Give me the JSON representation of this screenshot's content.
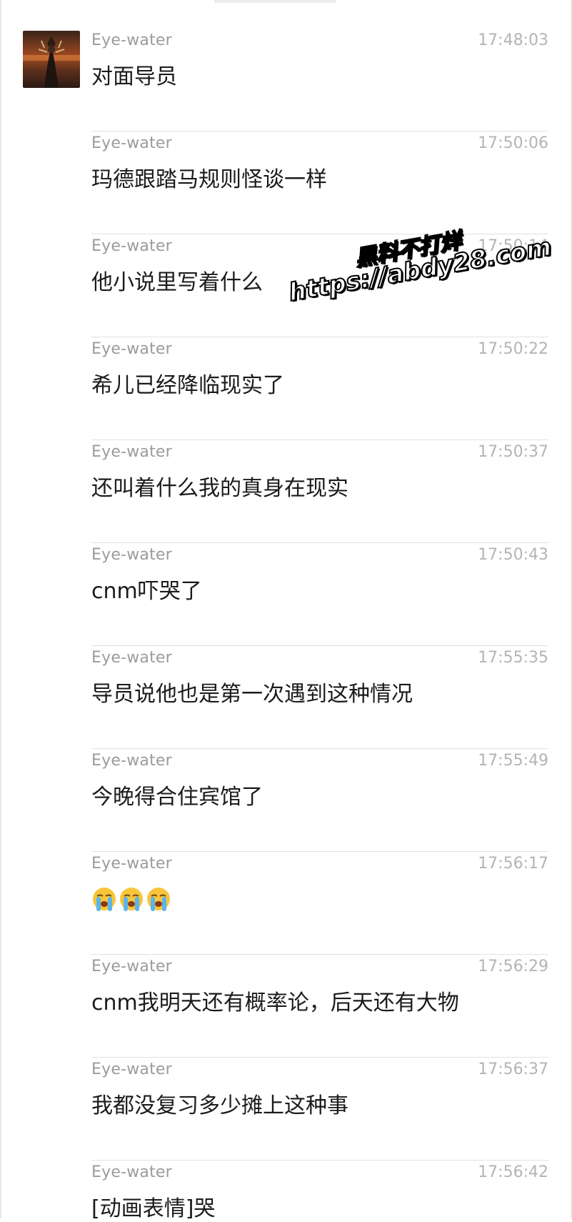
{
  "messages": [
    {
      "sender": "Eye-water",
      "time": "17:48:03",
      "text": "对面导员"
    },
    {
      "sender": "Eye-water",
      "time": "17:50:06",
      "text": "玛德跟踏马规则怪谈一样"
    },
    {
      "sender": "Eye-water",
      "time": "17:50:14",
      "text": "他小说里写着什么"
    },
    {
      "sender": "Eye-water",
      "time": "17:50:22",
      "text": "希儿已经降临现实了"
    },
    {
      "sender": "Eye-water",
      "time": "17:50:37",
      "text": "还叫着什么我的真身在现实"
    },
    {
      "sender": "Eye-water",
      "time": "17:50:43",
      "text": "cnm吓哭了"
    },
    {
      "sender": "Eye-water",
      "time": "17:55:35",
      "text": "导员说他也是第一次遇到这种情况"
    },
    {
      "sender": "Eye-water",
      "time": "17:55:49",
      "text": "今晚得合住宾馆了"
    },
    {
      "sender": "Eye-water",
      "time": "17:56:17",
      "emoji": [
        "loudly-crying-face",
        "loudly-crying-face",
        "loudly-crying-face"
      ]
    },
    {
      "sender": "Eye-water",
      "time": "17:56:29",
      "text": "cnm我明天还有概率论，后天还有大物"
    },
    {
      "sender": "Eye-water",
      "time": "17:56:37",
      "text": "我都没复习多少摊上这种事"
    },
    {
      "sender": "Eye-water",
      "time": "17:56:42",
      "text": "[动画表情]哭"
    }
  ],
  "watermark": {
    "line1": "黑料不打烊",
    "line2": "https://abdy28.com"
  },
  "colors": {
    "sender": "#9b9b9b",
    "time": "#b4b4b4",
    "text": "#1b1b1b",
    "separator": "#e2e2e2",
    "background": "#ffffff"
  }
}
